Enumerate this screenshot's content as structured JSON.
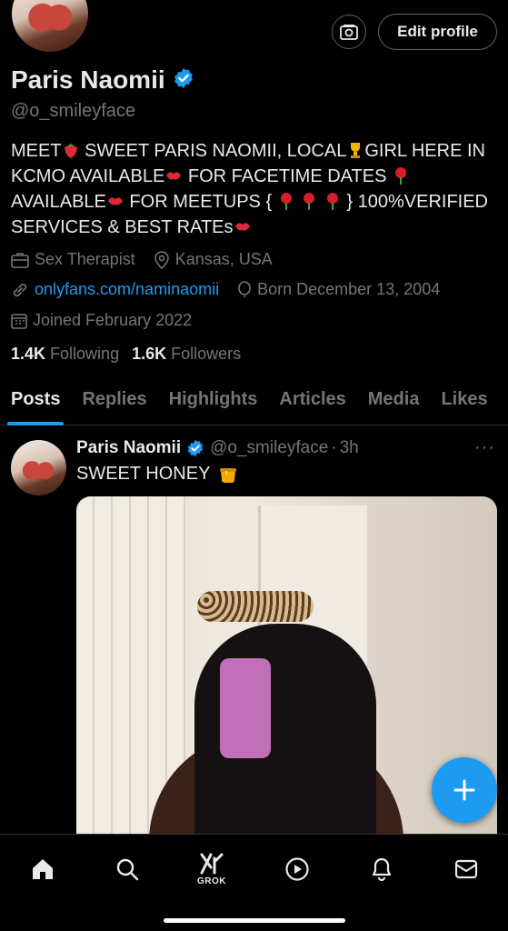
{
  "header": {
    "edit_profile_label": "Edit profile",
    "icon": "camera-square-icon"
  },
  "profile": {
    "name": "Paris Naomii",
    "handle": "@o_smileyface",
    "verified_icon": "verified-badge-icon",
    "bio": {
      "p1": "MEET",
      "p2": " SWEET PARIS NAOMII, LOCAL",
      "p3": "GIRL HERE IN KCMO AVAILABLE",
      "p4": " FOR FACETIME DATES ",
      "p5": "AVAILABLE",
      "p6": " FOR MEETUPS {",
      "p7": "} 100%VERIFIED SERVICES & BEST RATEs"
    },
    "category": "Sex Therapist",
    "location": "Kansas, USA",
    "website": "onlyfans.com/naminaomii",
    "born": "Born December 13, 2004",
    "joined": "Joined February 2022",
    "following_count": "1.4K",
    "following_label": "Following",
    "followers_count": "1.6K",
    "followers_label": "Followers"
  },
  "tabs": [
    "Posts",
    "Replies",
    "Highlights",
    "Articles",
    "Media",
    "Likes"
  ],
  "active_tab": "Posts",
  "post": {
    "name": "Paris Naomii",
    "handle": "@o_smileyface",
    "time": "3h",
    "separator": "·",
    "text": "SWEET HONEY",
    "more": "···"
  },
  "colors": {
    "background": "#000000",
    "accent": "#1d9bf0",
    "secondary_text": "#71767b",
    "primary_text": "#e7e9ea"
  },
  "bottom_nav": {
    "items": [
      "home-icon",
      "search-icon",
      "grok-icon",
      "video-icon",
      "notifications-icon",
      "messages-icon"
    ],
    "grok_label": "GROK"
  }
}
